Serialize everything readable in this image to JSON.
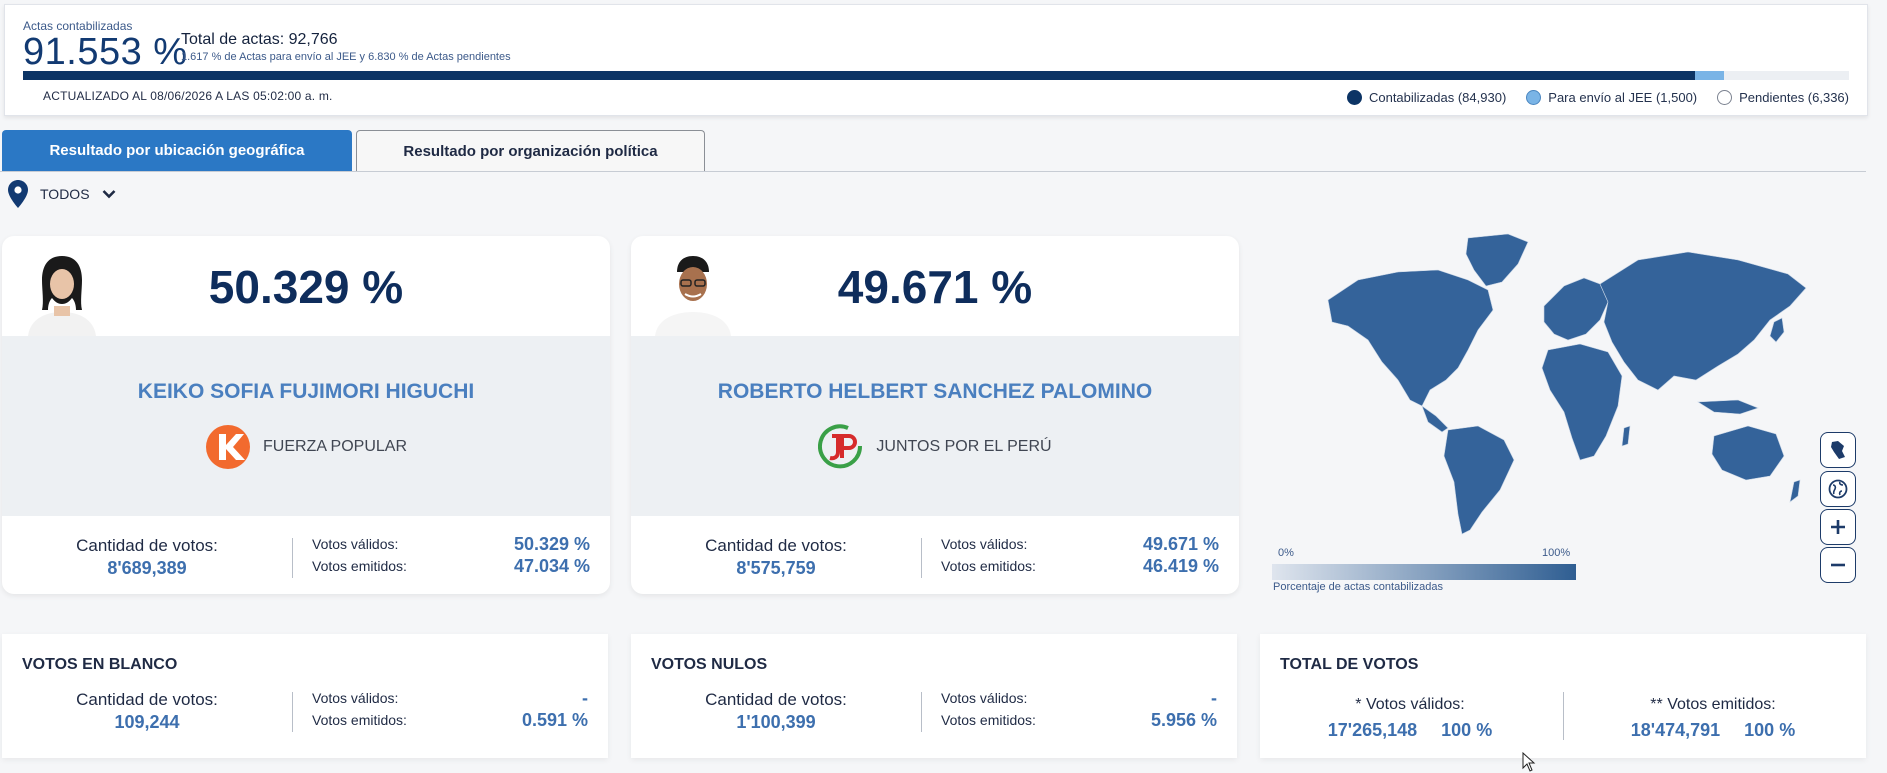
{
  "summary": {
    "actas_label": "Actas contabilizadas",
    "actas_pct": "91.553 %",
    "total_actas": "Total de actas: 92,766",
    "sub": "1.617 % de Actas para envío al JEE y 6.830 % de Actas pendientes",
    "updated": "ACTUALIZADO AL 08/06/2026 A LAS 05:02:00 a. m.",
    "progress": {
      "contabilizadas_pct": 91.553,
      "jee_pct": 1.617,
      "pendientes_pct": 6.83
    },
    "legend": [
      {
        "label": "Contabilizadas (84,930)",
        "color": "#0c3465"
      },
      {
        "label": "Para envío al JEE (1,500)",
        "color": "#7ab4e6"
      },
      {
        "label": "Pendientes (6,336)",
        "color": "#ffffff"
      }
    ]
  },
  "tabs": {
    "geo": "Resultado por ubicación geográfica",
    "org": "Resultado por organización política"
  },
  "location": {
    "value": "TODOS"
  },
  "candidates": [
    {
      "pct": "50.329 %",
      "name": "KEIKO SOFIA FUJIMORI HIGUCHI",
      "party": "FUERZA POPULAR",
      "party_logo_text": "K",
      "party_color": "#f26a2e",
      "votes_label": "Cantidad de votos:",
      "votes": "8'689,389",
      "validos_label": "Votos válidos:",
      "validos": "50.329 %",
      "emitidos_label": "Votos emitidos:",
      "emitidos": "47.034 %"
    },
    {
      "pct": "49.671 %",
      "name": "ROBERTO HELBERT SANCHEZ PALOMINO",
      "party": "JUNTOS POR EL PERÚ",
      "party_logo_text": "JP",
      "party_color": "#d62b2b",
      "votes_label": "Cantidad de votos:",
      "votes": "8'575,759",
      "validos_label": "Votos válidos:",
      "validos": "49.671 %",
      "emitidos_label": "Votos emitidos:",
      "emitidos": "46.419 %"
    }
  ],
  "map": {
    "scale_min": "0%",
    "scale_max": "100%",
    "caption": "Porcentaje de actas contabilizadas",
    "controls": [
      "peru-map-icon",
      "globe-icon",
      "zoom-in-icon",
      "zoom-out-icon"
    ]
  },
  "blank": {
    "title": "VOTOS EN BLANCO",
    "votes_label": "Cantidad de votos:",
    "votes": "109,244",
    "validos_label": "Votos válidos:",
    "validos": "-",
    "emitidos_label": "Votos emitidos:",
    "emitidos": "0.591 %"
  },
  "null_votes": {
    "title": "VOTOS NULOS",
    "votes_label": "Cantidad de votos:",
    "votes": "1'100,399",
    "validos_label": "Votos válidos:",
    "validos": "-",
    "emitidos_label": "Votos emitidos:",
    "emitidos": "5.956 %"
  },
  "total": {
    "title": "TOTAL DE VOTOS",
    "validos_label": "* Votos válidos:",
    "validos_votes": "17'265,148",
    "validos_pct": "100 %",
    "emitidos_label": "** Votos emitidos:",
    "emitidos_votes": "18'474,791",
    "emitidos_pct": "100 %"
  }
}
